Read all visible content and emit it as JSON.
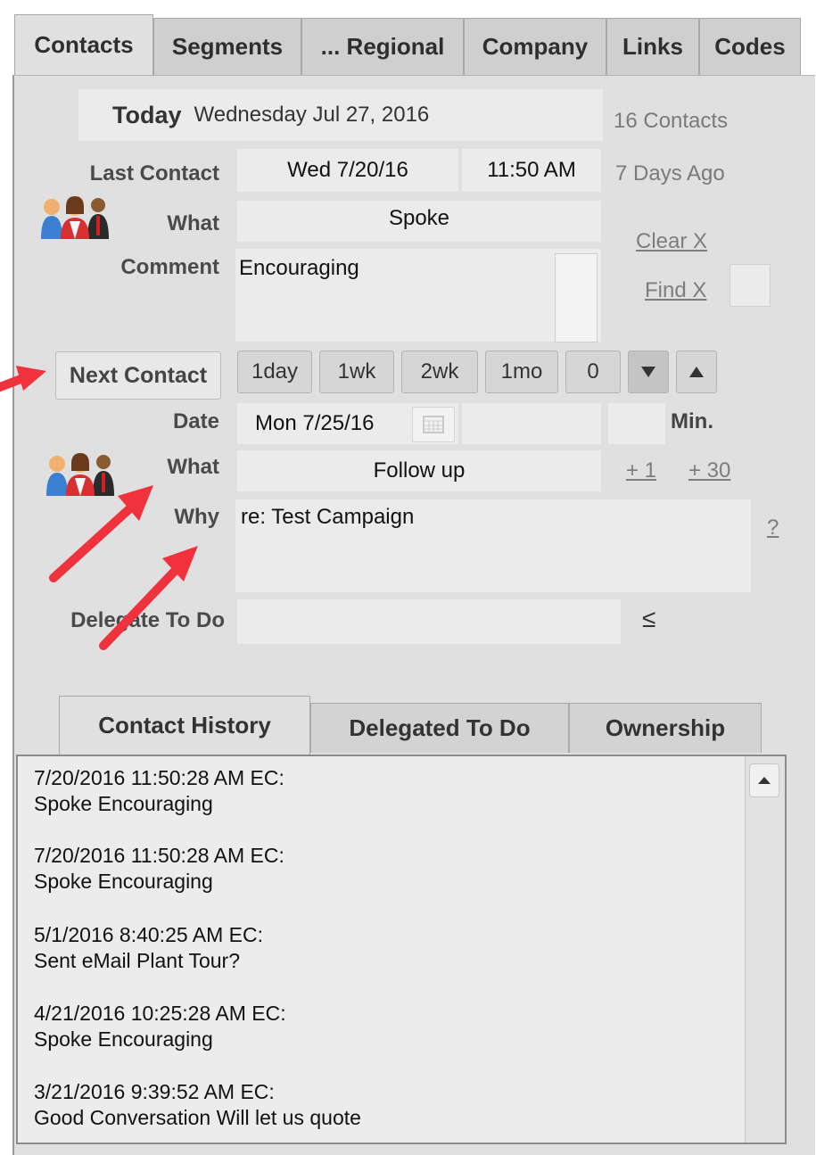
{
  "tabs": [
    "Contacts",
    "Segments",
    "... Regional",
    "Company",
    "Links",
    "Codes"
  ],
  "today": {
    "label": "Today",
    "date": "Wednesday Jul 27, 2016",
    "count": "16 Contacts"
  },
  "last_contact": {
    "label": "Last Contact",
    "date": "Wed 7/20/16",
    "time": "11:50 AM",
    "ago": "7 Days Ago",
    "what_label": "What",
    "what": "Spoke",
    "comment_label": "Comment",
    "comment": "Encouraging"
  },
  "links": {
    "clear": "Clear X",
    "find": "Find X",
    "plus1": "+ 1",
    "plus30": "+ 30",
    "help": "?",
    "delegate_arrow": "≤"
  },
  "next_contact": {
    "button": "Next Contact",
    "quick": [
      "1day",
      "1wk",
      "2wk",
      "1mo"
    ],
    "counter": "0",
    "date_label": "Date",
    "date": "Mon 7/25/16",
    "min_label": "Min.",
    "what_label": "What",
    "what": "Follow up",
    "why_label": "Why",
    "why": "re: Test Campaign"
  },
  "delegate": {
    "label": "Delegate To Do",
    "value": ""
  },
  "bottom_tabs": [
    "Contact History",
    "Delegated To Do",
    "Ownership"
  ],
  "history": [
    {
      "header": "7/20/2016 11:50:28 AM EC:",
      "body": "Spoke Encouraging"
    },
    {
      "header": "7/20/2016 11:50:28 AM EC:",
      "body": "Spoke Encouraging"
    },
    {
      "header": "5/1/2016 8:40:25 AM EC:",
      "body": "Sent eMail Plant Tour?"
    },
    {
      "header": "4/21/2016 10:25:28 AM EC:",
      "body": "Spoke Encouraging"
    },
    {
      "header": "3/21/2016 9:39:52 AM EC:",
      "body": "Good Conversation Will let us quote"
    }
  ],
  "colors": {
    "annotation_arrow": "#f0323c",
    "panel": "#e0e0e0",
    "field": "#ebebeb"
  },
  "icons": {
    "people": "people-group-icon",
    "calendar": "calendar-icon",
    "down": "arrow-down-icon",
    "up": "arrow-up-icon",
    "scroll_up": "scroll-up-icon"
  }
}
